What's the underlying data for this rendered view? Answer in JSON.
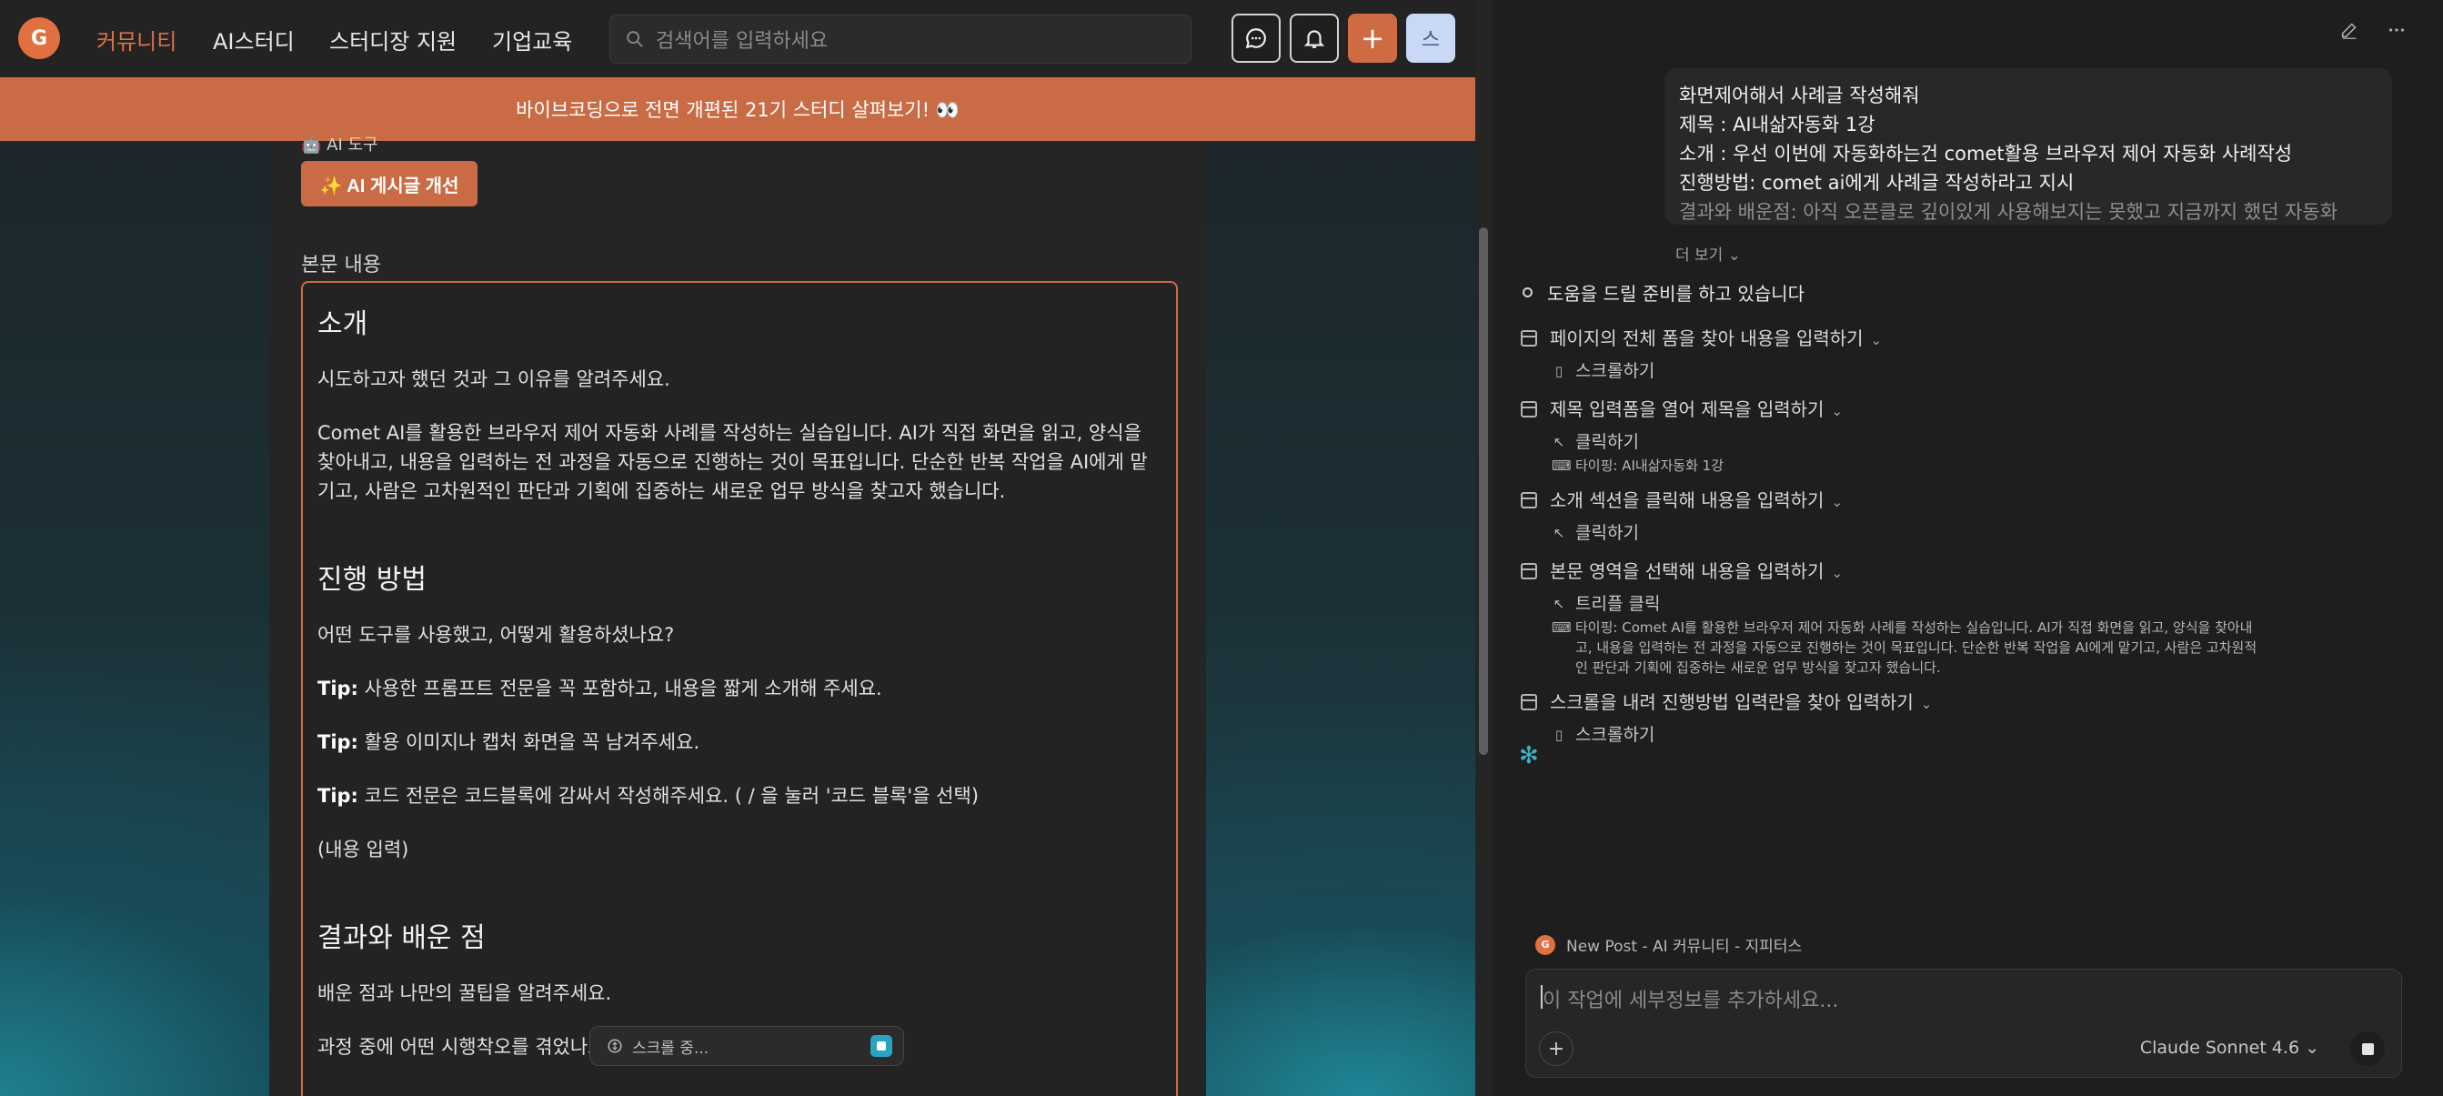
{
  "brand": {
    "logo_text": "G"
  },
  "nav": {
    "links": [
      "커뮤니티",
      "AI스터디",
      "스터디장 지원",
      "기업교육"
    ],
    "search_placeholder": "검색어를 입력하세요",
    "user_initial": "스"
  },
  "banner": {
    "text": "바이브코딩으로 전면 개편된 21기 스터디 살펴보기! 👀"
  },
  "editor": {
    "ai_tool_label": "🤖 AI 도구",
    "ai_improve_button": "✨ AI 게시글 개선",
    "body_label": "본문 내용",
    "sections": [
      {
        "heading": "소개",
        "paragraphs": [
          {
            "text": "시도하고자 했던 것과 그 이유를 알려주세요."
          },
          {
            "text": "Comet AI를 활용한 브라우저 제어 자동화 사례를 작성하는 실습입니다. AI가 직접 화면을 읽고, 양식을 찾아내고, 내용을 입력하는 전 과정을 자동으로 진행하는 것이 목표입니다. 단순한 반복 작업을 AI에게 맡기고, 사람은 고차원적인 판단과 기획에 집중하는 새로운 업무 방식을 찾고자 했습니다."
          }
        ]
      },
      {
        "heading": "진행 방법",
        "paragraphs": [
          {
            "text": "어떤 도구를 사용했고, 어떻게 활용하셨나요?"
          },
          {
            "tip": "Tip:",
            "text": " 사용한 프롬프트 전문을 꼭 포함하고, 내용을 짧게 소개해 주세요."
          },
          {
            "tip": "Tip:",
            "text": " 활용 이미지나 캡처 화면을 꼭 남겨주세요."
          },
          {
            "tip": "Tip:",
            "text": " 코드 전문은 코드블록에 감싸서 작성해주세요. ( / 을 눌러 '코드 블록'을 선택)"
          },
          {
            "text": "(내용 입력)"
          }
        ]
      },
      {
        "heading": "결과와 배운 점",
        "paragraphs": [
          {
            "text": "배운 점과 나만의 꿀팁을 알려주세요."
          },
          {
            "text": "과정 중에 어떤 시행착오를 겪었나요?"
          }
        ]
      }
    ],
    "scrolling_indicator": "스크롤 중..."
  },
  "assistant": {
    "user_message": [
      "화면제어해서 사례글 작성해줘",
      "제목 : AI내삶자동화 1강",
      "소개 : 우선 이번에 자동화하는건 comet활용 브라우저 제어 자동화 사례작성",
      "진행방법: comet ai에게 사례글 작성하라고 지시",
      "결과와 배운점: 아직 오픈클로 깊이있게 사용해보지는 못했고 지금까지 했던 자동화"
    ],
    "more_label": "더 보기",
    "status": "도움을 드릴 준비를 하고 있습니다",
    "steps": [
      {
        "title": "페이지의 전체 폼을 찾아 내용을 입력하기",
        "actions": [
          {
            "icon": "scroll",
            "text": "스크롤하기"
          }
        ]
      },
      {
        "title": "제목 입력폼을 열어 제목을 입력하기",
        "actions": [
          {
            "icon": "click",
            "text": "클릭하기"
          },
          {
            "icon": "type",
            "text": "타이핑: AI내삶자동화 1강",
            "small": true
          }
        ]
      },
      {
        "title": "소개 섹션을 클릭해 내용을 입력하기",
        "actions": [
          {
            "icon": "click",
            "text": "클릭하기"
          }
        ]
      },
      {
        "title": "본문 영역을 선택해 내용을 입력하기",
        "actions": [
          {
            "icon": "click",
            "text": "트리플 클릭"
          },
          {
            "icon": "type",
            "text": "타이핑: Comet AI를 활용한 브라우저 제어 자동화 사례를 작성하는 실습입니다. AI가 직접 화면을 읽고, 양식을 찾아내고, 내용을 입력하는 전 과정을 자동으로 진행하는 것이 목표입니다. 단순한 반복 작업을 AI에게 맡기고, 사람은 고차원적인 판단과 기획에 집중하는 새로운 업무 방식을 찾고자 했습니다.",
            "small": true
          }
        ]
      },
      {
        "title": "스크롤을 내려 진행방법 입력란을 찾아 입력하기",
        "actions": [
          {
            "icon": "scroll",
            "text": "스크롤하기"
          }
        ]
      }
    ],
    "tab_reference": "New Post - AI 커뮤니티 - 지피터스",
    "composer_placeholder": "이 작업에 세부정보를 추가하세요...",
    "model": "Claude Sonnet 4.6"
  },
  "colors": {
    "accent": "#c96c45",
    "spinner": "#3ab2c9"
  }
}
